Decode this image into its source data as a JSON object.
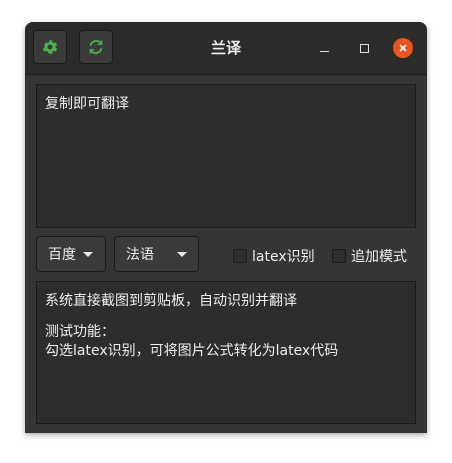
{
  "window": {
    "title": "兰译"
  },
  "header": {
    "settings_icon": "gear-icon",
    "refresh_icon": "refresh-icon"
  },
  "source": {
    "text": "复制即可翻译"
  },
  "toolbar": {
    "engine": "百度",
    "language": "法语",
    "latex_label": "latex识别",
    "latex_checked": false,
    "append_label": "追加模式",
    "append_checked": false
  },
  "output": {
    "line1": "系统直接截图到剪贴板，自动识别并翻译",
    "line2": "测试功能：",
    "line3": "勾选latex识别，可将图片公式转化为latex代码"
  },
  "colors": {
    "accent_close": "#e95420",
    "icon_green": "#4caf50"
  }
}
